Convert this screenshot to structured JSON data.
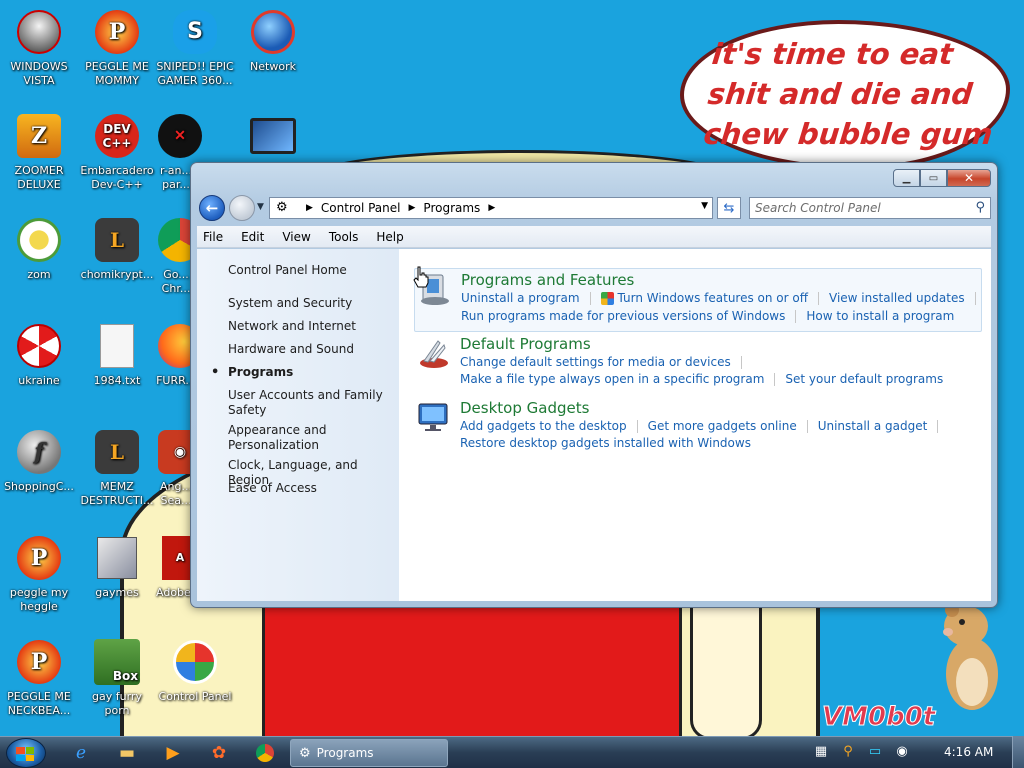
{
  "wallpaper": {
    "speech_text": "it's time to eat shit and die and chew bubble gum",
    "signature": "VM0b0t"
  },
  "desktop_icons": [
    {
      "label": "WINDOWS VISTA",
      "icon": "vista-orb-icon"
    },
    {
      "label": "PEGGLE ME MOMMY",
      "icon": "peggle-icon"
    },
    {
      "label": "SNIPED!! EPIC GAMER 360...",
      "icon": "skype-icon"
    },
    {
      "label": "Network",
      "icon": "network-globe-icon"
    },
    {
      "label": "ZOOMER DELUXE",
      "icon": "zoomer-icon"
    },
    {
      "label": "Embarcadero Dev-C++",
      "icon": "devcpp-icon"
    },
    {
      "label": "r-an... par...",
      "icon": "r-antipar-icon"
    },
    {
      "label": "zom",
      "icon": "flower-icon"
    },
    {
      "label": "chomikrypt...",
      "icon": "shortcut-clock-icon"
    },
    {
      "label": "Go... Chr...",
      "icon": "chrome-icon"
    },
    {
      "label": "ukraine",
      "icon": "radiation-icon"
    },
    {
      "label": "1984.txt",
      "icon": "text-file-icon"
    },
    {
      "label": "FURR...",
      "icon": "firefox-icon"
    },
    {
      "label": "ShoppingC...",
      "icon": "flash-icon"
    },
    {
      "label": "MEMZ DESTRUCTI...",
      "icon": "shortcut-clock-icon"
    },
    {
      "label": "Ang... Sea...",
      "icon": "angry-birds-icon"
    },
    {
      "label": "peggle my heggle",
      "icon": "peggle-icon"
    },
    {
      "label": "gaymes",
      "icon": "games-folder-icon"
    },
    {
      "label": "Adobe...",
      "icon": "adobe-icon"
    },
    {
      "label": "PEGGLE ME NECKBEA...",
      "icon": "peggle-icon"
    },
    {
      "label": "gay furry porn",
      "icon": "hamster-box-icon"
    },
    {
      "label": "Control Panel",
      "icon": "control-panel-icon"
    }
  ],
  "window": {
    "address": {
      "root_icon": "control-panel-icon",
      "crumbs": [
        "Control Panel",
        "Programs"
      ]
    },
    "search_placeholder": "Search Control Panel",
    "menu": [
      "File",
      "Edit",
      "View",
      "Tools",
      "Help"
    ],
    "sidebar": [
      "Control Panel Home",
      "System and Security",
      "Network and Internet",
      "Hardware and Sound",
      "Programs",
      "User Accounts and Family Safety",
      "Appearance and Personalization",
      "Clock, Language, and Region",
      "Ease of Access"
    ],
    "sidebar_active": "Programs",
    "categories": [
      {
        "title": "Programs and Features",
        "icon": "programs-features-icon",
        "row1": [
          "Uninstall a program",
          "Turn Windows features on or off",
          "View installed updates"
        ],
        "row2": [
          "Run programs made for previous versions of Windows",
          "How to install a program"
        ]
      },
      {
        "title": "Default Programs",
        "icon": "default-programs-icon",
        "row1": [
          "Change default settings for media or devices"
        ],
        "row2": [
          "Make a file type always open in a specific program",
          "Set your default programs"
        ]
      },
      {
        "title": "Desktop Gadgets",
        "icon": "desktop-gadgets-icon",
        "row1": [
          "Add gadgets to the desktop",
          "Get more gadgets online",
          "Uninstall a gadget"
        ],
        "row2": [
          "Restore desktop gadgets installed with Windows"
        ]
      }
    ]
  },
  "taskbar": {
    "pinned": [
      "internet-explorer-icon",
      "folder-icon",
      "media-player-icon",
      "app-icon",
      "chrome-icon"
    ],
    "active_task": "Programs",
    "clock": "4:16 AM"
  },
  "colors": {
    "desktop": "#1aa3de",
    "category_title": "#1e7a35",
    "link": "#1a62b2"
  }
}
